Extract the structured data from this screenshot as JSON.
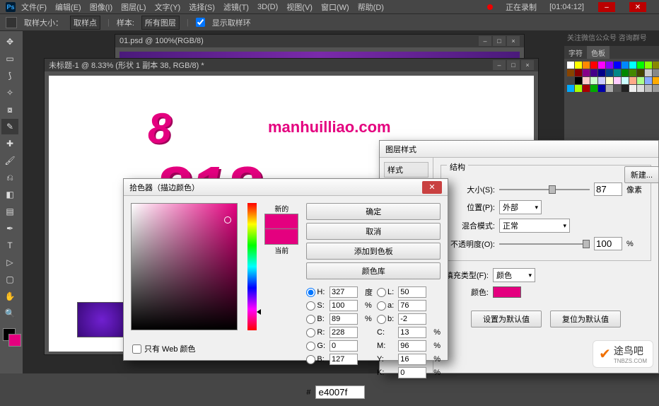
{
  "menu": {
    "items": [
      "文件(F)",
      "编辑(E)",
      "图像(I)",
      "图层(L)",
      "文字(Y)",
      "选择(S)",
      "滤镜(T)",
      "3D(D)",
      "视图(V)",
      "窗口(W)",
      "帮助(D)"
    ]
  },
  "recording": {
    "label": "正在录制",
    "time": "[01:04:12]"
  },
  "optbar": {
    "sample_label": "取样大小：",
    "sample_value": "取样点",
    "layers_label": "样本:",
    "layers_value": "所有图层",
    "show_ring": "显示取样环"
  },
  "doc1": {
    "title": "01.psd @ 100%(RGB/8)"
  },
  "doc2": {
    "title": "未标题-1 @ 8.33% (形状 1 副本 38, RGB/8) *",
    "art_main": "8",
    "art_sub": "manhuilliao.com",
    "art_big": "818"
  },
  "panels": {
    "tabs": [
      "字符",
      "色板"
    ],
    "banner": "关注微信公众号  咨询群号"
  },
  "picker": {
    "title": "拾色器（描边颜色）",
    "new_label": "新的",
    "cur_label": "当前",
    "ok": "确定",
    "cancel": "取消",
    "add": "添加到色板",
    "libs": "颜色库",
    "H": "327",
    "S": "100",
    "B_hsb": "89",
    "R": "228",
    "G": "0",
    "B_rgb": "127",
    "L": "50",
    "a": "76",
    "b": "-2",
    "C": "13",
    "M": "96",
    "Y": "16",
    "K": "0",
    "hex": "e4007f",
    "web_only": "只有 Web 颜色",
    "deg": "度",
    "pct": "%"
  },
  "lstyle": {
    "title": "图层样式",
    "left_header": "样式",
    "group_struct": "结构",
    "size_label": "大小(S):",
    "size_val": "87",
    "size_unit": "像素",
    "pos_label": "位置(P):",
    "pos_val": "外部",
    "blend_label": "混合模式:",
    "blend_val": "正常",
    "opacity_label": "不透明度(O):",
    "opacity_val": "100",
    "opacity_unit": "%",
    "fill_label": "填充类型(F):",
    "fill_val": "颜色",
    "color_label": "颜色:",
    "btn_default": "设置为默认值",
    "btn_reset": "复位为默认值",
    "btn_new": "新建..."
  },
  "logo": {
    "name": "途鸟吧",
    "url": "TNBZS.COM"
  },
  "swatch_colors": [
    "#fff",
    "#ff0",
    "#f80",
    "#f00",
    "#f0f",
    "#80f",
    "#00f",
    "#08f",
    "#0ff",
    "#0f0",
    "#8f0",
    "#880",
    "#840",
    "#800",
    "#808",
    "#408",
    "#008",
    "#048",
    "#088",
    "#080",
    "#480",
    "#440",
    "#ccc",
    "#888",
    "#444",
    "#000",
    "#fcc",
    "#cfc",
    "#ccf",
    "#ffc",
    "#fcf",
    "#cff",
    "#fa8",
    "#af8",
    "#8af",
    "#fa0",
    "#0af",
    "#af0",
    "#a00",
    "#0a0",
    "#00a",
    "#aaa",
    "#555",
    "#222",
    "#eee",
    "#ddd",
    "#bbb",
    "#999"
  ]
}
